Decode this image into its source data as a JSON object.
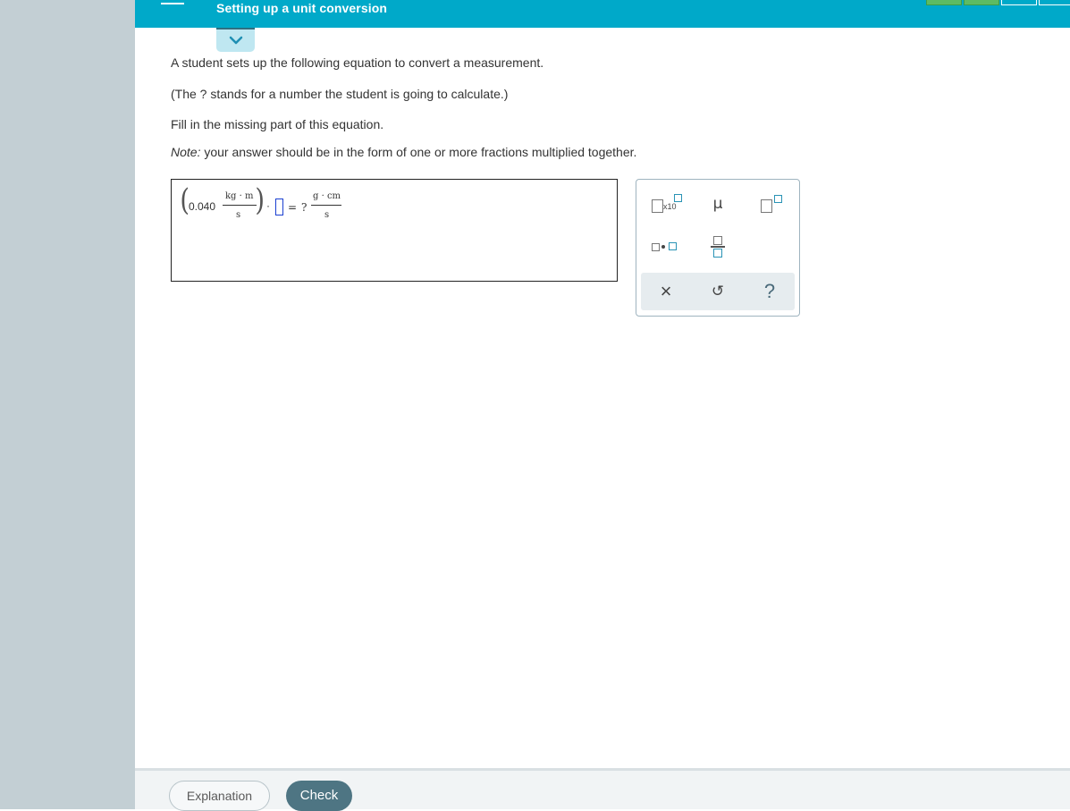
{
  "header": {
    "title": "Setting up a unit conversion",
    "progress": {
      "completed": 2,
      "total": 4
    }
  },
  "question": {
    "line1": "A student sets up the following equation to convert a measurement.",
    "line2": "(The ? stands for a number the student is going to calculate.)",
    "line3": "Fill in the missing part of this equation.",
    "note_label": "Note:",
    "note_text": " your answer should be in the form of one or more fractions multiplied together."
  },
  "equation": {
    "value": "0.040",
    "lhs_numerator": "kg · m",
    "lhs_denominator": "s",
    "multiply": "·",
    "equals": "=",
    "unknown": "?",
    "rhs_numerator": "g · cm",
    "rhs_denominator": "s"
  },
  "palette": {
    "sci_notation_label": "x10",
    "mu_symbol": "μ",
    "clear_symbol": "×",
    "undo_symbol": "↺",
    "help_symbol": "?"
  },
  "footer": {
    "explanation_label": "Explanation",
    "check_label": "Check"
  }
}
